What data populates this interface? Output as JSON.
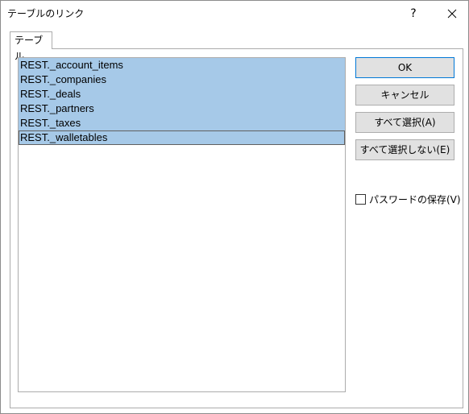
{
  "window": {
    "title": "テーブルのリンク",
    "help_label": "?"
  },
  "tab": {
    "label": "テーブル"
  },
  "tables": [
    {
      "name": "REST._account_items"
    },
    {
      "name": "REST._companies"
    },
    {
      "name": "REST._deals"
    },
    {
      "name": "REST._partners"
    },
    {
      "name": "REST._taxes"
    },
    {
      "name": "REST._walletables"
    }
  ],
  "buttons": {
    "ok": "OK",
    "cancel": "キャンセル",
    "select_all": "すべて選択(A)",
    "select_none": "すべて選択しない(E)"
  },
  "save_password": {
    "label": "パスワードの保存(V)",
    "checked": false
  },
  "colors": {
    "selection": "#a6c9e8",
    "default_button_border": "#0078d7",
    "button_face": "#e1e1e1"
  },
  "icons": {
    "close": "close-icon",
    "help": "help-icon"
  }
}
